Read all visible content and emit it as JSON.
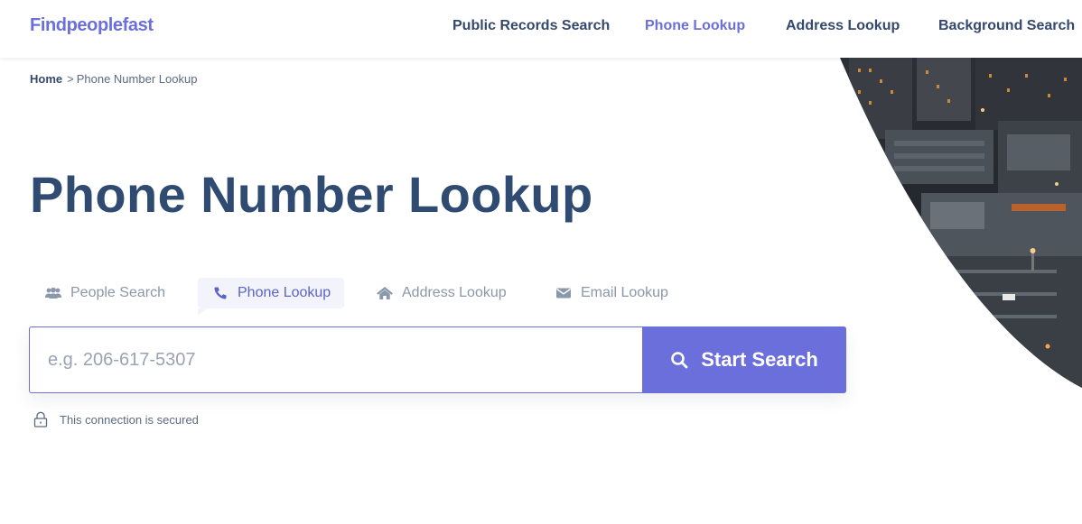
{
  "header": {
    "logo": "Findpeoplefast",
    "nav": [
      {
        "label": "Public Records Search"
      },
      {
        "label": "Phone Lookup"
      },
      {
        "label": "Address Lookup"
      },
      {
        "label": "Background Search"
      }
    ],
    "active_nav": "Phone Lookup"
  },
  "breadcrumb": {
    "home": "Home",
    "separator": ">",
    "current": "Phone Number Lookup"
  },
  "page_title": "Phone Number Lookup",
  "tabs": [
    {
      "label": "People Search",
      "icon": "users-icon"
    },
    {
      "label": "Phone Lookup",
      "icon": "phone-icon"
    },
    {
      "label": "Address Lookup",
      "icon": "home-icon"
    },
    {
      "label": "Email Lookup",
      "icon": "envelope-icon"
    }
  ],
  "active_tab": "Phone Lookup",
  "search": {
    "placeholder": "e.g. 206-617-5307",
    "value": "",
    "button_label": "Start Search",
    "button_icon": "search-icon"
  },
  "security_note": {
    "text": "This connection is secured",
    "icon": "lock-icon"
  },
  "hero_image": {
    "subject": "night city rooftop photo"
  },
  "colors": {
    "brand": "#6b6fdc",
    "heading": "#2f4b72",
    "nav_text": "#34496d",
    "muted_text": "#8b97aa",
    "active_tab_bg": "#f2f3fb"
  }
}
